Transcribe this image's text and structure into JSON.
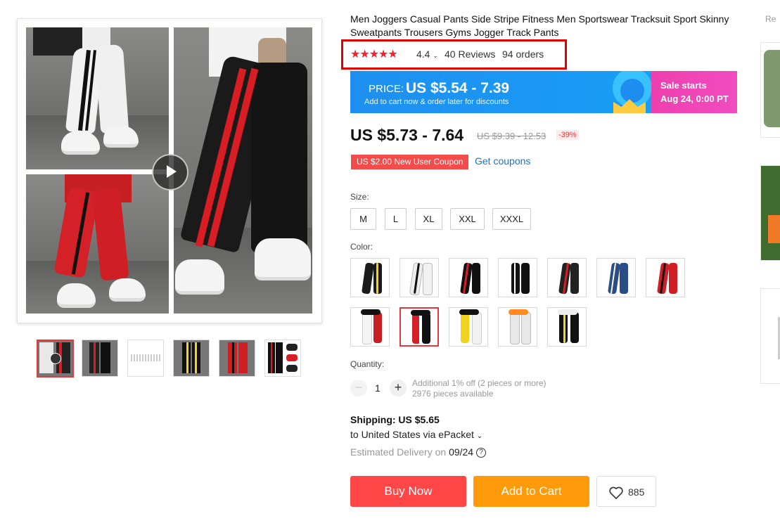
{
  "product": {
    "title": "Men Joggers Casual Pants Side Stripe Fitness Men Sportswear Tracksuit Sport Skinny Sweatpants Trousers Gyms Jogger Track Pants",
    "stars": "★★★★★",
    "rating": "4.4",
    "reviews": "40 Reviews",
    "orders": "94 orders"
  },
  "banner": {
    "price_label": "PRICE:",
    "price_value": "US $5.54 - 7.39",
    "subtitle": "Add to cart now & order later for discounts",
    "sale_line1": "Sale starts",
    "sale_line2": "Aug 24, 0:00 PT"
  },
  "pricing": {
    "current": "US $5.73 - 7.64",
    "original": "US $9.39 - 12.53",
    "discount": "-39%",
    "coupon": "US $2.00 New User Coupon",
    "get_coupons": "Get coupons"
  },
  "size": {
    "label": "Size:",
    "options": [
      "M",
      "L",
      "XL",
      "XXL",
      "XXXL"
    ]
  },
  "color": {
    "label": "Color:",
    "selected_index": 8
  },
  "quantity": {
    "label": "Quantity:",
    "minus": "−",
    "value": "1",
    "plus": "+",
    "note1": "Additional 1% off (2 pieces or more)",
    "note2": "2976 pieces available"
  },
  "shipping": {
    "line1": "Shipping: US $5.65",
    "line2": "to United States via ePacket",
    "delivery_label": "Estimated Delivery on",
    "delivery_date": "09/24"
  },
  "actions": {
    "buy_now": "Buy Now",
    "add_to_cart": "Add to Cart",
    "wishlist_count": "885"
  },
  "recommend": {
    "label": "Re"
  },
  "colors": {
    "accent_red": "#ff4747",
    "accent_orange": "#ff9b0a",
    "banner_blue": "#1e8ff0",
    "sale_pink": "#ef3fae",
    "link_blue": "#1a73c8"
  }
}
